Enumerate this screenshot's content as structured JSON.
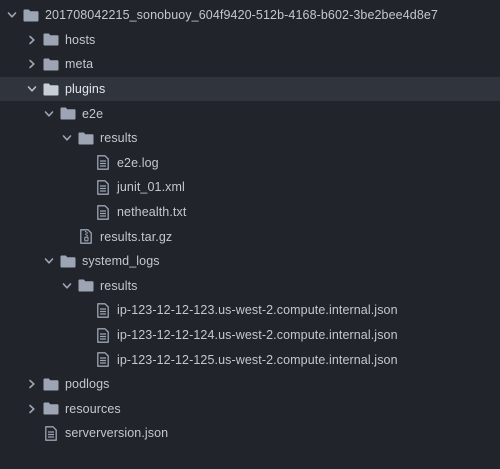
{
  "tree": {
    "root": {
      "label": "201708042215_sonobuoy_604f9420-512b-4168-b602-3be2bee4d8e7",
      "icon": "folder-icon",
      "expanded": true
    },
    "items": [
      {
        "label": "hosts",
        "type": "folder",
        "expanded": false
      },
      {
        "label": "meta",
        "type": "folder",
        "expanded": false
      },
      {
        "label": "plugins",
        "type": "folder",
        "expanded": true,
        "selected": true
      },
      {
        "label": "e2e",
        "type": "folder",
        "expanded": true
      },
      {
        "label": "results",
        "type": "folder",
        "expanded": true
      },
      {
        "label": "e2e.log",
        "type": "file"
      },
      {
        "label": "junit_01.xml",
        "type": "file"
      },
      {
        "label": "nethealth.txt",
        "type": "file"
      },
      {
        "label": "results.tar.gz",
        "type": "archive"
      },
      {
        "label": "systemd_logs",
        "type": "folder",
        "expanded": true
      },
      {
        "label": "results",
        "type": "folder",
        "expanded": true
      },
      {
        "label": "ip-123-12-12-123.us-west-2.compute.internal.json",
        "type": "file"
      },
      {
        "label": "ip-123-12-12-124.us-west-2.compute.internal.json",
        "type": "file"
      },
      {
        "label": "ip-123-12-12-125.us-west-2.compute.internal.json",
        "type": "file"
      },
      {
        "label": "podlogs",
        "type": "folder",
        "expanded": false
      },
      {
        "label": "resources",
        "type": "folder",
        "expanded": false
      },
      {
        "label": "serverversion.json",
        "type": "file"
      }
    ]
  },
  "colors": {
    "background": "#21252b",
    "selected_row": "#2f343d",
    "text": "#c4c8ce",
    "icon": "#9da5b4"
  }
}
